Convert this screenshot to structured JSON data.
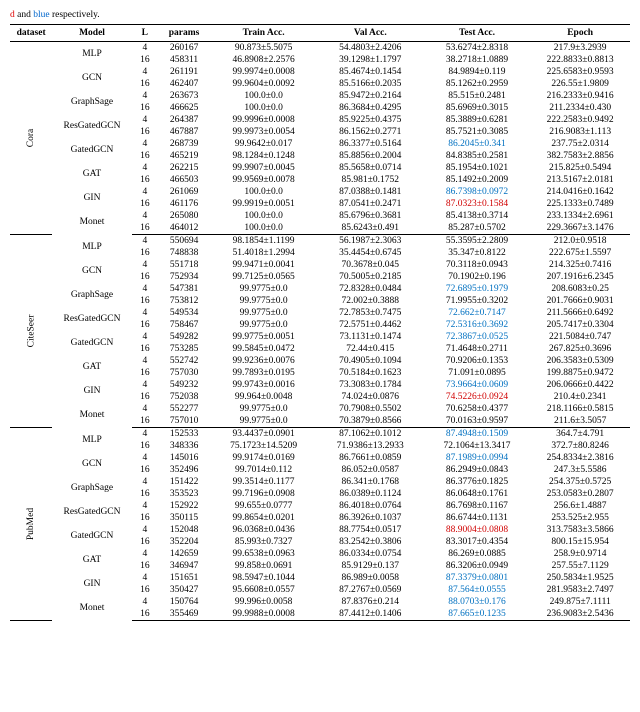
{
  "caption_prefix": "d",
  "caption_mid": " and ",
  "caption_blue": "blue",
  "caption_suffix": " respectively.",
  "headers": {
    "dataset": "dataset",
    "model": "Model",
    "L": "L",
    "params": "params",
    "train": "Train Acc.",
    "val": "Val Acc.",
    "test": "Test Acc.",
    "epoch": "Epoch"
  },
  "datasets": [
    {
      "name": "Cora",
      "models": [
        {
          "name": "MLP",
          "rows": [
            {
              "L": "4",
              "params": "260167",
              "train": "90.873±5.5075",
              "val": "54.4803±2.4206",
              "test": "53.6274±2.8318",
              "epoch": "217.9±3.2939"
            },
            {
              "L": "16",
              "params": "458311",
              "train": "46.8908±2.2576",
              "val": "39.1298±1.1797",
              "test": "38.2718±1.0889",
              "epoch": "222.8833±0.8813"
            }
          ]
        },
        {
          "name": "GCN",
          "rows": [
            {
              "L": "4",
              "params": "261191",
              "train": "99.9974±0.0008",
              "val": "85.4674±0.1454",
              "test": "84.9894±0.119",
              "epoch": "225.6583±0.9593"
            },
            {
              "L": "16",
              "params": "462407",
              "train": "99.9604±0.0092",
              "val": "85.5166±0.2035",
              "test": "85.1262±0.2959",
              "epoch": "226.55±1.9809"
            }
          ]
        },
        {
          "name": "GraphSage",
          "rows": [
            {
              "L": "4",
              "params": "263673",
              "train": "100.0±0.0",
              "val": "85.9472±0.2164",
              "test": "85.515±0.2481",
              "epoch": "216.2333±0.9416"
            },
            {
              "L": "16",
              "params": "466625",
              "train": "100.0±0.0",
              "val": "86.3684±0.4295",
              "test": "85.6969±0.3015",
              "epoch": "211.2334±0.430"
            }
          ]
        },
        {
          "name": "ResGatedGCN",
          "rows": [
            {
              "L": "4",
              "params": "264387",
              "train": "99.9996±0.0008",
              "val": "85.9225±0.4375",
              "test": "85.3889±0.6281",
              "epoch": "222.2583±0.9492"
            },
            {
              "L": "16",
              "params": "467887",
              "train": "99.9973±0.0054",
              "val": "86.1562±0.2771",
              "test": "85.7521±0.3085",
              "epoch": "216.9083±1.113"
            }
          ]
        },
        {
          "name": "GatedGCN",
          "rows": [
            {
              "L": "4",
              "params": "268739",
              "train": "99.9642±0.017",
              "val": "86.3377±0.5164",
              "test": "86.2045±0.341",
              "test_cls": "blue-val",
              "epoch": "237.75±2.0314"
            },
            {
              "L": "16",
              "params": "465219",
              "train": "98.1284±0.1248",
              "val": "85.8856±0.2004",
              "test": "84.8385±0.2581",
              "epoch": "382.7583±2.8856"
            }
          ]
        },
        {
          "name": "GAT",
          "rows": [
            {
              "L": "4",
              "params": "262215",
              "train": "99.9907±0.0045",
              "val": "85.5658±0.0714",
              "test": "85.1954±0.1021",
              "epoch": "215.825±0.5494"
            },
            {
              "L": "16",
              "params": "466503",
              "train": "99.9569±0.0078",
              "val": "85.981±0.1752",
              "test": "85.1492±0.2009",
              "epoch": "213.5167±2.0181"
            }
          ]
        },
        {
          "name": "GIN",
          "rows": [
            {
              "L": "4",
              "params": "261069",
              "train": "100.0±0.0",
              "val": "87.0388±0.1481",
              "test": "86.7398±0.0972",
              "test_cls": "blue-val",
              "epoch": "214.0416±0.1642"
            },
            {
              "L": "16",
              "params": "461176",
              "train": "99.9919±0.0051",
              "val": "87.0541±0.2471",
              "test": "87.0323±0.1584",
              "test_cls": "red-val",
              "epoch": "225.1333±0.7489"
            }
          ]
        },
        {
          "name": "Monet",
          "rows": [
            {
              "L": "4",
              "params": "265080",
              "train": "100.0±0.0",
              "val": "85.6796±0.3681",
              "test": "85.4138±0.3714",
              "epoch": "233.1334±2.6961"
            },
            {
              "L": "16",
              "params": "464012",
              "train": "100.0±0.0",
              "val": "85.6243±0.491",
              "test": "85.287±0.5702",
              "epoch": "229.3667±3.1476"
            }
          ]
        }
      ]
    },
    {
      "name": "CiteSeer",
      "models": [
        {
          "name": "MLP",
          "rows": [
            {
              "L": "4",
              "params": "550694",
              "train": "98.1854±1.1199",
              "val": "56.1987±2.3063",
              "test": "55.3595±2.2809",
              "epoch": "212.0±0.9518"
            },
            {
              "L": "16",
              "params": "748838",
              "train": "51.4018±1.2994",
              "val": "35.4454±0.6745",
              "test": "35.347±0.8122",
              "epoch": "222.675±1.5597"
            }
          ]
        },
        {
          "name": "GCN",
          "rows": [
            {
              "L": "4",
              "params": "551718",
              "train": "99.9471±0.0041",
              "val": "70.3678±0.045",
              "test": "70.3118±0.0943",
              "epoch": "214.325±0.7416"
            },
            {
              "L": "16",
              "params": "752934",
              "train": "99.7125±0.0565",
              "val": "70.5005±0.2185",
              "test": "70.1902±0.196",
              "epoch": "207.1916±6.2345"
            }
          ]
        },
        {
          "name": "GraphSage",
          "rows": [
            {
              "L": "4",
              "params": "547381",
              "train": "99.9775±0.0",
              "val": "72.8328±0.0484",
              "test": "72.6895±0.1979",
              "test_cls": "blue-val",
              "epoch": "208.6083±0.25"
            },
            {
              "L": "16",
              "params": "753812",
              "train": "99.9775±0.0",
              "val": "72.002±0.3888",
              "test": "71.9955±0.3202",
              "epoch": "201.7666±0.9031"
            }
          ]
        },
        {
          "name": "ResGatedGCN",
          "rows": [
            {
              "L": "4",
              "params": "549534",
              "train": "99.9775±0.0",
              "val": "72.7853±0.7475",
              "test": "72.662±0.7147",
              "test_cls": "blue-val",
              "epoch": "211.5666±0.6492"
            },
            {
              "L": "16",
              "params": "758467",
              "train": "99.9775±0.0",
              "val": "72.5751±0.4462",
              "test": "72.5316±0.3692",
              "test_cls": "blue-val",
              "epoch": "205.7417±0.3304"
            }
          ]
        },
        {
          "name": "GatedGCN",
          "rows": [
            {
              "L": "4",
              "params": "549282",
              "train": "99.9775±0.0051",
              "val": "73.1131±0.1474",
              "test": "72.3867±0.0525",
              "test_cls": "blue-val",
              "epoch": "221.5084±0.747"
            },
            {
              "L": "16",
              "params": "753285",
              "train": "99.5845±0.0472",
              "val": "72.44±0.415",
              "test": "71.4648±0.2711",
              "epoch": "267.825±0.3696"
            }
          ]
        },
        {
          "name": "GAT",
          "rows": [
            {
              "L": "4",
              "params": "552742",
              "train": "99.9236±0.0076",
              "val": "70.4905±0.1094",
              "test": "70.9206±0.1353",
              "epoch": "206.3583±0.5309"
            },
            {
              "L": "16",
              "params": "757030",
              "train": "99.7893±0.0195",
              "val": "70.5184±0.1623",
              "test": "71.091±0.0895",
              "epoch": "199.8875±0.9472"
            }
          ]
        },
        {
          "name": "GIN",
          "rows": [
            {
              "L": "4",
              "params": "549232",
              "train": "99.9743±0.0016",
              "val": "73.3083±0.1784",
              "test": "73.9664±0.0609",
              "test_cls": "blue-val",
              "epoch": "206.0666±0.4422"
            },
            {
              "L": "16",
              "params": "752038",
              "train": "99.964±0.0048",
              "val": "74.024±0.0876",
              "test": "74.5226±0.0924",
              "test_cls": "red-val",
              "epoch": "210.4±0.2341"
            }
          ]
        },
        {
          "name": "Monet",
          "rows": [
            {
              "L": "4",
              "params": "552277",
              "train": "99.9775±0.0",
              "val": "70.7908±0.5502",
              "test": "70.6258±0.4377",
              "epoch": "218.1166±0.5815"
            },
            {
              "L": "16",
              "params": "757010",
              "train": "99.9775±0.0",
              "val": "70.3879±0.8566",
              "test": "70.0163±0.9597",
              "epoch": "211.6±3.5057"
            }
          ]
        }
      ]
    },
    {
      "name": "PubMed",
      "models": [
        {
          "name": "MLP",
          "rows": [
            {
              "L": "4",
              "params": "152533",
              "train": "93.4437±0.0901",
              "val": "87.1062±0.1012",
              "test": "87.4948±0.1509",
              "test_cls": "blue-val",
              "epoch": "364.7±4.791"
            },
            {
              "L": "16",
              "params": "348336",
              "train": "75.1723±14.5209",
              "val": "71.9386±13.2933",
              "test": "72.1064±13.3417",
              "epoch": "372.7±80.8246"
            }
          ]
        },
        {
          "name": "GCN",
          "rows": [
            {
              "L": "4",
              "params": "145016",
              "train": "99.9174±0.0169",
              "val": "86.7661±0.0859",
              "test": "87.1989±0.0994",
              "test_cls": "blue-val",
              "epoch": "254.8334±2.3816"
            },
            {
              "L": "16",
              "params": "352496",
              "train": "99.7014±0.112",
              "val": "86.052±0.0587",
              "test": "86.2949±0.0843",
              "epoch": "247.3±5.5586"
            }
          ]
        },
        {
          "name": "GraphSage",
          "rows": [
            {
              "L": "4",
              "params": "151422",
              "train": "99.3514±0.1177",
              "val": "86.341±0.1768",
              "test": "86.3776±0.1825",
              "epoch": "254.375±0.5725"
            },
            {
              "L": "16",
              "params": "353523",
              "train": "99.7196±0.0908",
              "val": "86.0389±0.1124",
              "test": "86.0648±0.1761",
              "epoch": "253.0583±0.2807"
            }
          ]
        },
        {
          "name": "ResGatedGCN",
          "rows": [
            {
              "L": "4",
              "params": "152922",
              "train": "99.655±0.0777",
              "val": "86.4018±0.0764",
              "test": "86.7698±0.1167",
              "epoch": "256.6±1.4887"
            },
            {
              "L": "16",
              "params": "350115",
              "train": "99.8654±0.0201",
              "val": "86.3926±0.1037",
              "test": "86.6744±0.1131",
              "epoch": "253.525±2.955"
            }
          ]
        },
        {
          "name": "GatedGCN",
          "rows": [
            {
              "L": "4",
              "params": "152048",
              "train": "96.0368±0.0436",
              "val": "88.7754±0.0517",
              "test": "88.9004±0.0808",
              "test_cls": "red-val",
              "epoch": "313.7583±3.5866"
            },
            {
              "L": "16",
              "params": "352204",
              "train": "85.993±0.7327",
              "val": "83.2542±0.3806",
              "test": "83.3017±0.4354",
              "epoch": "800.15±15.954"
            }
          ]
        },
        {
          "name": "GAT",
          "rows": [
            {
              "L": "4",
              "params": "142659",
              "train": "99.6538±0.0963",
              "val": "86.0334±0.0754",
              "test": "86.269±0.0885",
              "epoch": "258.9±0.9714"
            },
            {
              "L": "16",
              "params": "346947",
              "train": "99.858±0.0691",
              "val": "85.9129±0.137",
              "test": "86.3206±0.0949",
              "epoch": "257.55±7.1129"
            }
          ]
        },
        {
          "name": "GIN",
          "rows": [
            {
              "L": "4",
              "params": "151651",
              "train": "98.5947±0.1044",
              "val": "86.989±0.0058",
              "test": "87.3379±0.0801",
              "test_cls": "blue-val",
              "epoch": "250.5834±1.9525"
            },
            {
              "L": "16",
              "params": "350427",
              "train": "95.6608±0.0557",
              "val": "87.2767±0.0569",
              "test": "87.564±0.0555",
              "test_cls": "blue-val",
              "epoch": "281.9583±2.7497"
            }
          ]
        },
        {
          "name": "Monet",
          "rows": [
            {
              "L": "4",
              "params": "150764",
              "train": "99.996±0.0058",
              "val": "87.8376±0.214",
              "test": "88.0703±0.176",
              "test_cls": "blue-val",
              "epoch": "249.875±7.1111"
            },
            {
              "L": "16",
              "params": "355469",
              "train": "99.9988±0.0008",
              "val": "87.4412±0.1406",
              "test": "87.665±0.1235",
              "test_cls": "blue-val",
              "epoch": "236.9083±2.5436"
            }
          ]
        }
      ]
    }
  ]
}
